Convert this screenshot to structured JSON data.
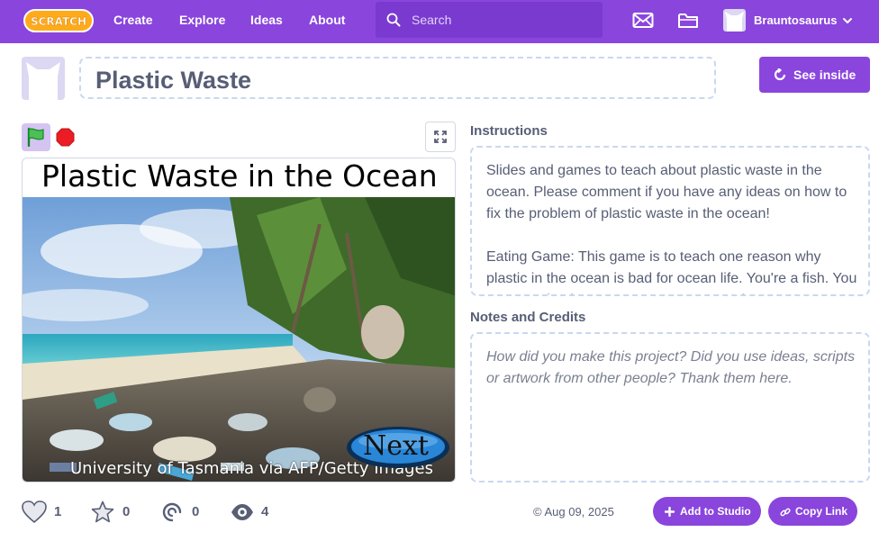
{
  "nav": {
    "logo_text": "SCRATCH",
    "links": [
      "Create",
      "Explore",
      "Ideas",
      "About"
    ],
    "search_placeholder": "Search",
    "username": "Brauntosaurus",
    "icons": [
      "messages-icon",
      "my-stuff-folder-icon",
      "user-avatar",
      "chevron-down-icon"
    ],
    "accent": "#8a45dd"
  },
  "project": {
    "title": "Plastic Waste",
    "see_inside_label": "See inside"
  },
  "stage": {
    "heading": "Plastic Waste in the Ocean",
    "next_label": "Next",
    "photo_credit": "University of Tasmania via AFP/Getty Images"
  },
  "instructions": {
    "label": "Instructions",
    "text": "Slides and games to teach about plastic waste in the ocean. Please comment if you have any ideas on how to fix the problem of plastic waste in the ocean!\n\nEating Game: This game is to teach one reason why plastic in the ocean is bad for ocean life. You're a fish. You must eat food. Move your mouse around..."
  },
  "notes": {
    "label": "Notes and Credits",
    "placeholder": "How did you make this project? Did you use ideas, scripts or artwork from other people? Thank them here."
  },
  "stats": {
    "loves": "1",
    "favorites": "0",
    "remixes": "0",
    "views": "4"
  },
  "footer": {
    "date": "© Aug 09, 2025",
    "add_to_studio_label": "Add to Studio",
    "copy_link_label": "Copy Link"
  }
}
